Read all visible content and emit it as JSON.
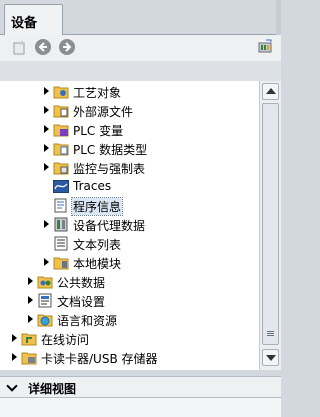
{
  "tabs": {
    "devices": "设备"
  },
  "toolbar": {
    "new_icon": "new-item-icon",
    "back_icon": "back-arrow-icon",
    "forward_icon": "forward-arrow-icon",
    "overview_icon": "device-overview-icon"
  },
  "tree": {
    "items": [
      {
        "label": "工艺对象",
        "icon": "technology-object-icon",
        "level": 2,
        "expandable": true
      },
      {
        "label": "外部源文件",
        "icon": "external-source-icon",
        "level": 2,
        "expandable": true
      },
      {
        "label": "PLC 变量",
        "icon": "plc-tags-icon",
        "level": 2,
        "expandable": true
      },
      {
        "label": "PLC 数据类型",
        "icon": "plc-datatype-icon",
        "level": 2,
        "expandable": true
      },
      {
        "label": "监控与强制表",
        "icon": "watch-table-icon",
        "level": 2,
        "expandable": true
      },
      {
        "label": "Traces",
        "icon": "trace-icon",
        "level": 2,
        "expandable": false
      },
      {
        "label": "程序信息",
        "icon": "program-info-icon",
        "level": 2,
        "expandable": false,
        "selected": true
      },
      {
        "label": "设备代理数据",
        "icon": "device-proxy-icon",
        "level": 2,
        "expandable": true
      },
      {
        "label": "文本列表",
        "icon": "text-list-icon",
        "level": 2,
        "expandable": false
      },
      {
        "label": "本地模块",
        "icon": "local-modules-icon",
        "level": 2,
        "expandable": true
      },
      {
        "label": "公共数据",
        "icon": "common-data-icon",
        "level": 1,
        "expandable": true
      },
      {
        "label": "文档设置",
        "icon": "document-settings-icon",
        "level": 1,
        "expandable": true
      },
      {
        "label": "语言和资源",
        "icon": "languages-resources-icon",
        "level": 1,
        "expandable": true
      },
      {
        "label": "在线访问",
        "icon": "online-access-icon",
        "level": 0,
        "expandable": true
      },
      {
        "label": "卡读卡器/USB 存储器",
        "icon": "card-reader-icon",
        "level": 0,
        "expandable": true
      }
    ]
  },
  "detail_view": {
    "label": "详细视图"
  },
  "colors": {
    "selection": "#dbe6f4",
    "tab_bg": "#f1f2f4",
    "panel_bg": "#d3d8df"
  }
}
